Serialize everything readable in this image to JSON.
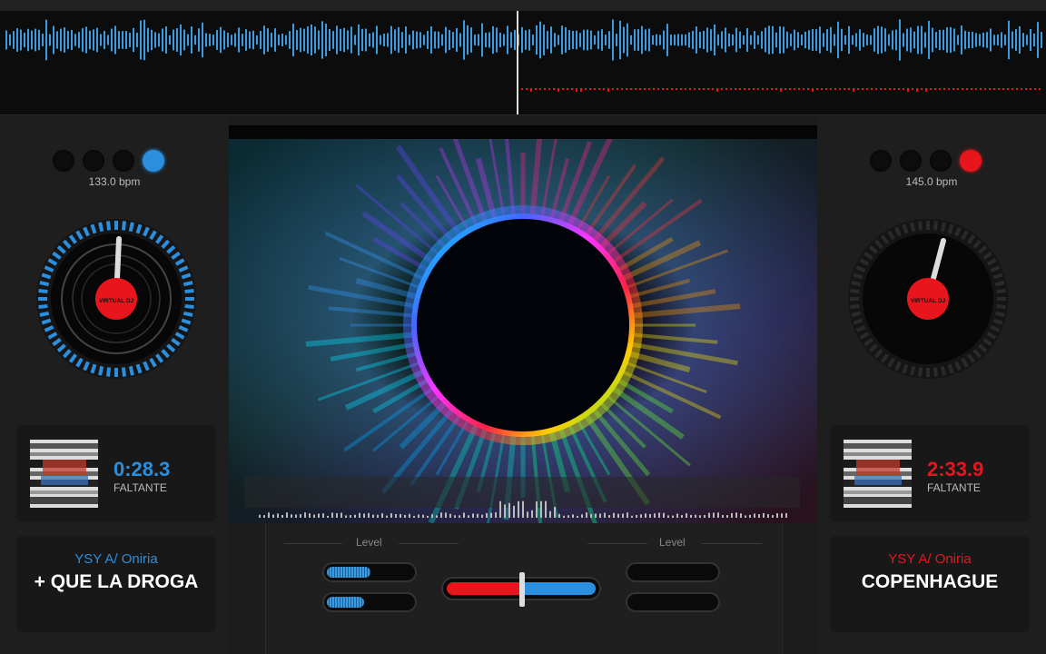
{
  "colors": {
    "deck_left_accent": "#2b8fdf",
    "deck_right_accent": "#e8161c"
  },
  "waveform": {
    "icon": "waveform-display"
  },
  "deck_left": {
    "bpm": "133.0 bpm",
    "time_remaining": "0:28.3",
    "time_label": "FALTANTE",
    "artist": "YSY A/ Oniria",
    "title": "+ QUE LA DROGA",
    "platter_logo": "VIRTUAL DJ"
  },
  "deck_right": {
    "bpm": "145.0 bpm",
    "time_remaining": "2:33.9",
    "time_label": "FALTANTE",
    "artist": "YSY A/ Oniria",
    "title": "COPENHAGUE",
    "platter_logo": "VIRTUAL DJ"
  },
  "mixer": {
    "left_level_label": "Level",
    "right_level_label": "Level",
    "left_meter_top": 0.52,
    "left_meter_bottom": 0.45,
    "right_meter_top": 0,
    "right_meter_bottom": 0,
    "crossfader_position": 0.5
  },
  "video": {
    "icon": "visualizer-ring"
  }
}
